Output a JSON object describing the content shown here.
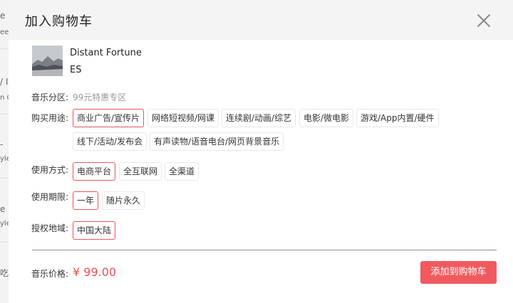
{
  "background_page": {
    "fragments": [
      "e F",
      "ee",
      "/ I",
      "n C",
      "-",
      "yle",
      "e",
      "yle",
      "吃"
    ]
  },
  "modal": {
    "title": "加入购物车",
    "close_icon": "close-icon"
  },
  "track": {
    "cover_icon": "album-cover-landscape",
    "title": "Distant Fortune",
    "artist": "ES"
  },
  "music_zone": {
    "label": "音乐分区:",
    "value": "99元特惠专区"
  },
  "purchase_usage": {
    "label": "购买用途:",
    "options": [
      "商业广告/宣传片",
      "网络短视频/网课",
      "连续剧/动画/综艺",
      "电影/微电影",
      "游戏/App内置/硬件",
      "线下/活动/发布会",
      "有声读物/语音电台/网页背景音乐"
    ],
    "selected": "商业广告/宣传片"
  },
  "usage_method": {
    "label": "使用方式:",
    "options": [
      "电商平台",
      "全互联网",
      "全渠道"
    ],
    "selected": "电商平台"
  },
  "usage_period": {
    "label": "使用期限:",
    "options": [
      "一年",
      "随片永久"
    ],
    "selected": "一年"
  },
  "license_region": {
    "label": "授权地域:",
    "options": [
      "中国大陆"
    ],
    "selected": "中国大陆"
  },
  "price": {
    "label": "音乐价格:",
    "value": "¥ 99.00"
  },
  "add_to_cart_button": "添加到购物车",
  "colors": {
    "accent": "#f05a5f",
    "price": "#ee4f4f",
    "selected_border": "#e8575d",
    "header_bg": "#f4f4f4"
  }
}
